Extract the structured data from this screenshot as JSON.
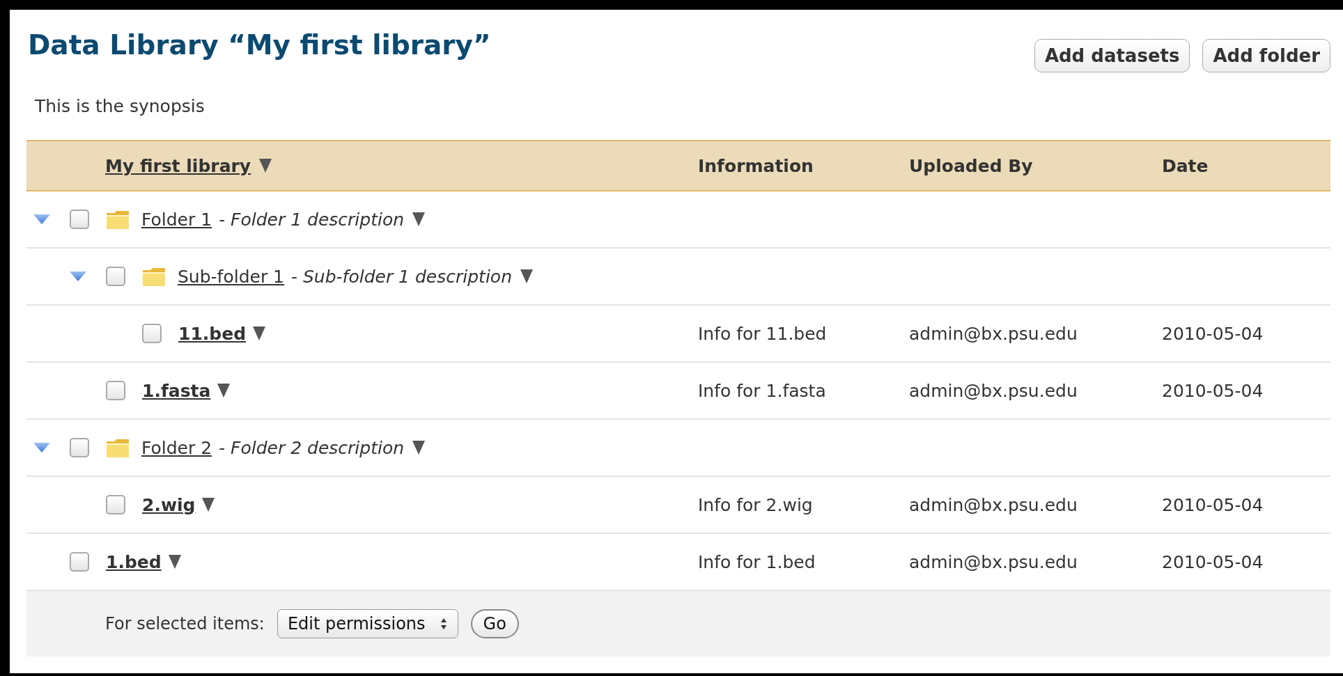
{
  "title": "Data Library “My first library”",
  "buttons": [
    "Add datasets",
    "Add folder"
  ],
  "synopsis": "This is the synopsis",
  "table": {
    "columns": [
      "My first library",
      "Information",
      "Uploaded By",
      "Date"
    ],
    "rows": [
      {
        "kind": "folder",
        "name": "Folder 1",
        "description": "- *Folder 1 description*",
        "expanded": true,
        "checked": false,
        "children": [
          {
            "kind": "folder",
            "name": "Sub-folder 1",
            "description": "- *Sub-folder 1 description*",
            "expanded": true,
            "checked": false,
            "children": [
              {
                "kind": "dataset",
                "name": "11.bed",
                "information": "Info for 11.bed",
                "uploaded_by": "admin@bx.psu.edu",
                "date": "2010-05-04",
                "checked": false
              }
            ]
          },
          {
            "kind": "dataset",
            "name": "1.fasta",
            "information": "Info for 1.fasta",
            "uploaded_by": "admin@bx.psu.edu",
            "date": "2010-05-04",
            "checked": false
          }
        ]
      },
      {
        "kind": "folder",
        "name": "Folder 2",
        "description": "- *Folder 2 description*",
        "expanded": true,
        "checked": false,
        "children": [
          {
            "kind": "dataset",
            "name": "2.wig",
            "information": "Info for 2.wig",
            "uploaded_by": "admin@bx.psu.edu",
            "date": "2010-05-04",
            "checked": false
          }
        ]
      },
      {
        "kind": "dataset",
        "name": "1.bed",
        "information": "Info for 1.bed",
        "uploaded_by": "admin@bx.psu.edu",
        "date": "2010-05-04",
        "checked": false
      }
    ]
  },
  "footer": {
    "label": "For selected items:",
    "action": "Edit permissions",
    "go": "Go"
  }
}
